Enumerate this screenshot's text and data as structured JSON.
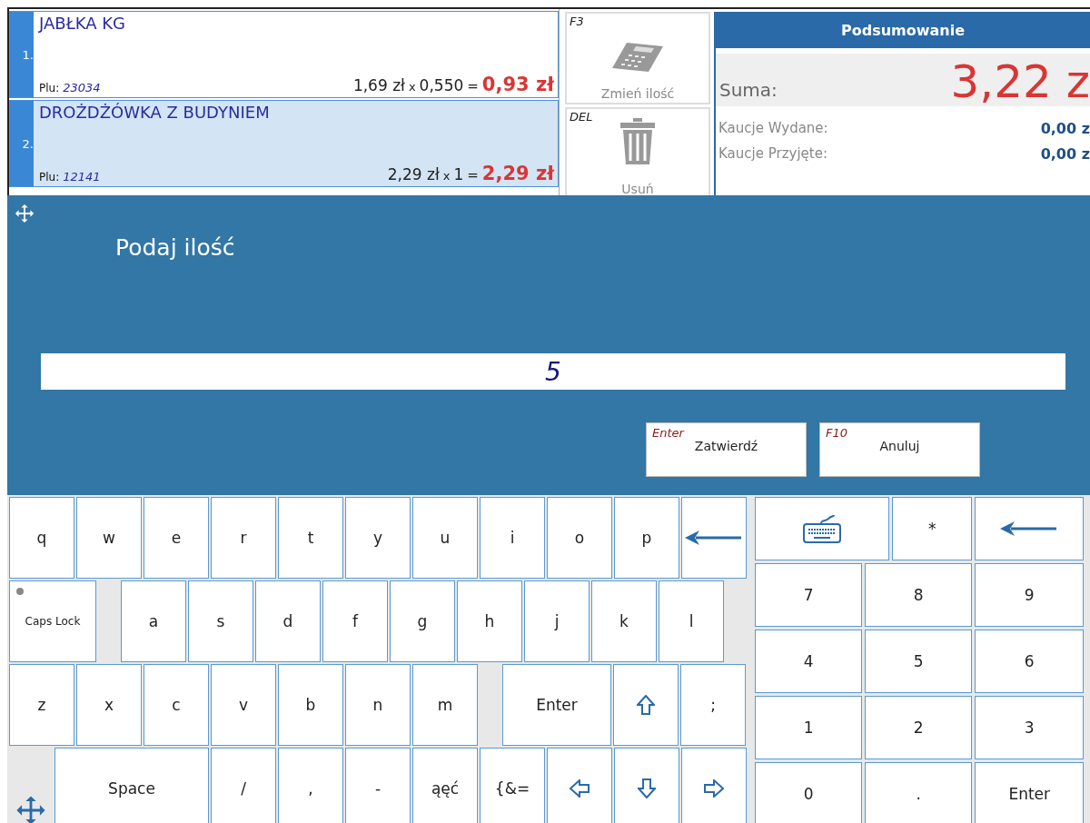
{
  "items": [
    {
      "number": "1.",
      "name": "JABŁKA KG",
      "plu_label": "Plu:",
      "plu": "23034",
      "price": "1,69 zł",
      "times": "x",
      "qty": "0,550",
      "equals": "=",
      "total": "0,93 zł",
      "selected": false
    },
    {
      "number": "2.",
      "name": "DROŻDŻÓWKA Z BUDYNIEM",
      "plu_label": "Plu:",
      "plu": "12141",
      "price": "2,29 zł",
      "times": "x",
      "qty": "1",
      "equals": "=",
      "total": "2,29 zł",
      "selected": true
    }
  ],
  "actions": [
    {
      "shortcut": "F3",
      "label": "Zmień ilość",
      "kind": "calculator"
    },
    {
      "shortcut": "DEL",
      "label": "Usuń",
      "kind": "trash"
    }
  ],
  "summary": {
    "title": "Podsumowanie",
    "total_label": "Suma:",
    "total": "3,22 z",
    "rows": [
      {
        "label": "Kaucje Wydane:",
        "value": "0,00 z"
      },
      {
        "label": "Kaucje Przyjęte:",
        "value": "0,00 z"
      }
    ]
  },
  "dialog": {
    "title": "Podaj ilość",
    "value": "5",
    "buttons": [
      {
        "shortcut": "Enter",
        "label": "Zatwierdź"
      },
      {
        "shortcut": "F10",
        "label": "Anuluj"
      }
    ]
  },
  "keyboard": {
    "rows": [
      {
        "keys": [
          {
            "kind": "char",
            "label": "q"
          },
          {
            "kind": "char",
            "label": "w"
          },
          {
            "kind": "char",
            "label": "e"
          },
          {
            "kind": "char",
            "label": "r"
          },
          {
            "kind": "char",
            "label": "t"
          },
          {
            "kind": "char",
            "label": "y"
          },
          {
            "kind": "char",
            "label": "u"
          },
          {
            "kind": "char",
            "label": "i"
          },
          {
            "kind": "char",
            "label": "o"
          },
          {
            "kind": "char",
            "label": "p"
          },
          {
            "kind": "backspace"
          }
        ]
      },
      {
        "keys": [
          {
            "kind": "caps",
            "label": "Caps Lock",
            "on": false
          },
          {
            "kind": "char",
            "label": "a"
          },
          {
            "kind": "char",
            "label": "s"
          },
          {
            "kind": "char",
            "label": "d"
          },
          {
            "kind": "char",
            "label": "f"
          },
          {
            "kind": "char",
            "label": "g"
          },
          {
            "kind": "char",
            "label": "h"
          },
          {
            "kind": "char",
            "label": "j"
          },
          {
            "kind": "char",
            "label": "k"
          },
          {
            "kind": "char",
            "label": "l"
          }
        ]
      },
      {
        "keys": [
          {
            "kind": "char",
            "label": "z"
          },
          {
            "kind": "char",
            "label": "x"
          },
          {
            "kind": "char",
            "label": "c"
          },
          {
            "kind": "char",
            "label": "v"
          },
          {
            "kind": "char",
            "label": "b"
          },
          {
            "kind": "char",
            "label": "n"
          },
          {
            "kind": "char",
            "label": "m"
          },
          {
            "kind": "enter",
            "label": "Enter"
          },
          {
            "kind": "shift"
          },
          {
            "kind": "char",
            "label": ";"
          }
        ]
      },
      {
        "keys": [
          {
            "kind": "move"
          },
          {
            "kind": "space",
            "label": "Space"
          },
          {
            "kind": "char",
            "label": "/"
          },
          {
            "kind": "char",
            "label": ","
          },
          {
            "kind": "char",
            "label": "-"
          },
          {
            "kind": "char",
            "label": "ąęć"
          },
          {
            "kind": "char",
            "label": "{&="
          },
          {
            "kind": "left"
          },
          {
            "kind": "down"
          },
          {
            "kind": "right"
          }
        ]
      }
    ]
  },
  "numpad": {
    "rows": [
      [
        {
          "kind": "keyboard"
        },
        {
          "kind": "char",
          "label": "*"
        },
        {
          "kind": "backspace"
        }
      ],
      [
        {
          "kind": "char",
          "label": "7"
        },
        {
          "kind": "char",
          "label": "8"
        },
        {
          "kind": "char",
          "label": "9"
        }
      ],
      [
        {
          "kind": "char",
          "label": "4"
        },
        {
          "kind": "char",
          "label": "5"
        },
        {
          "kind": "char",
          "label": "6"
        }
      ],
      [
        {
          "kind": "char",
          "label": "1"
        },
        {
          "kind": "char",
          "label": "2"
        },
        {
          "kind": "char",
          "label": "3"
        }
      ],
      [
        {
          "kind": "char",
          "label": "0"
        },
        {
          "kind": "char",
          "label": "."
        },
        {
          "kind": "enter",
          "label": "Enter"
        }
      ]
    ]
  }
}
